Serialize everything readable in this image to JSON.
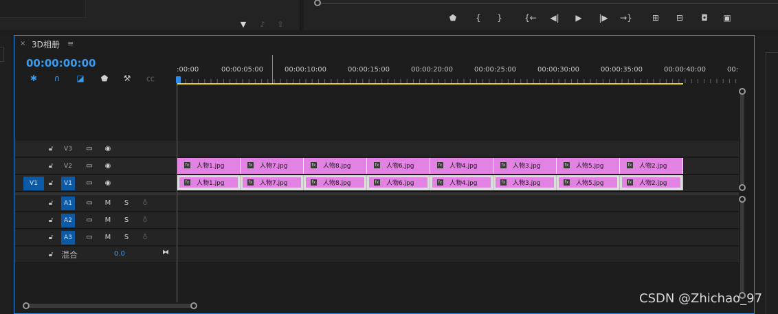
{
  "sequence": {
    "tab_title": "3D相册",
    "close_glyph": "×",
    "menu_glyph": "≡",
    "timecode": "00:00:00:00"
  },
  "ruler_labels": [
    ":00:00",
    "00:00:05:00",
    "00:00:10:00",
    "00:00:15:00",
    "00:00:20:00",
    "00:00:25:00",
    "00:00:30:00",
    "00:00:35:00",
    "00:00:40:00",
    "00:"
  ],
  "tracks": {
    "video": [
      {
        "name": "V3",
        "source": ""
      },
      {
        "name": "V2",
        "source": ""
      },
      {
        "name": "V1",
        "source": "V1"
      }
    ],
    "audio": [
      {
        "name": "A1",
        "m": "M",
        "s": "S"
      },
      {
        "name": "A2",
        "m": "M",
        "s": "S"
      },
      {
        "name": "A3",
        "m": "M",
        "s": "S"
      }
    ],
    "mix": {
      "label": "混合",
      "value": "0.0"
    }
  },
  "clips_v2": [
    "人物1.jpg",
    "人物7.jpg",
    "人物8.jpg",
    "人物6.jpg",
    "人物4.jpg",
    "人物3.jpg",
    "人物5.jpg",
    "人物2.jpg"
  ],
  "clips_v1": [
    "人物1.jpg",
    "人物7.jpg",
    "人物8.jpg",
    "人物6.jpg",
    "人物4.jpg",
    "人物3.jpg",
    "人物5.jpg",
    "人物2.jpg"
  ],
  "fx_label": "fx",
  "watermark": "CSDN @Zhichao_97",
  "colors": {
    "accent": "#2d8ceb",
    "clip": "#e282e2",
    "workbar": "#e8d21f",
    "track_selected": "#0c5aa6"
  }
}
